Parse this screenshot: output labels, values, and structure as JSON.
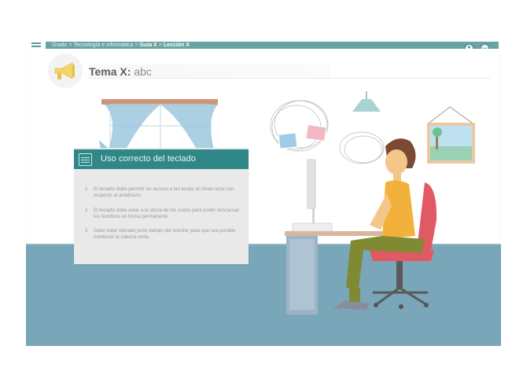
{
  "breadcrumb": {
    "grado": "Grado",
    "area": "Tecnología e informática",
    "guia": "Guía X",
    "leccion": "Lección X",
    "sep": ">"
  },
  "topic": {
    "label": "Tema X:",
    "value": "abc"
  },
  "card": {
    "title": "Uso correcto del teclado",
    "items": [
      {
        "num": "1",
        "text": "El teclado debe permitir un acceso a las teclas en línea recta con respecto al antebrazo."
      },
      {
        "num": "2",
        "text": "El teclado debe estar a la altura de los codos para poder descansar los hombros en forma permanente."
      },
      {
        "num": "3",
        "text": "Debe estar ubicado justo debajo del monitor para que sea posible mantener la cabeza recta."
      }
    ]
  },
  "colors": {
    "teal": "#2f8887",
    "bar": "#6aa3a3",
    "floor": "#7aa6b9"
  },
  "icons": {
    "menu": "hamburger-icon",
    "user": "user-icon",
    "down": "chevron-down-icon",
    "megaphone": "megaphone-icon",
    "notepad": "notepad-icon"
  }
}
